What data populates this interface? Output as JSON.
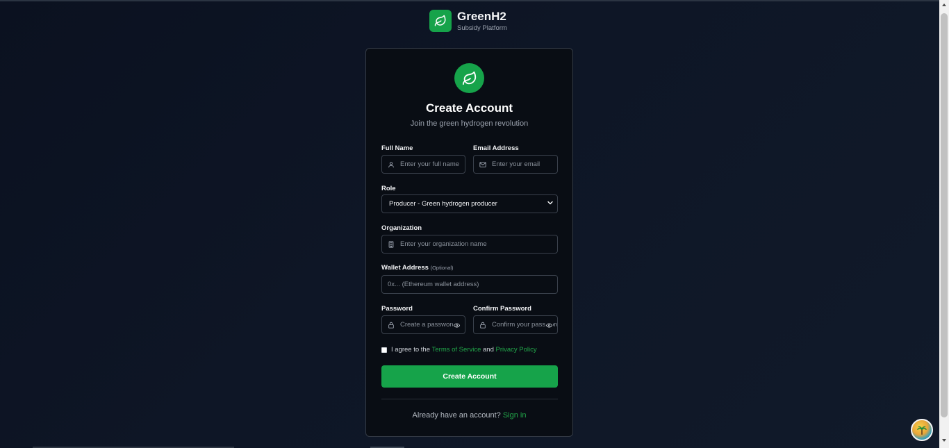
{
  "brand": {
    "name": "GreenH2",
    "subtitle": "Subsidy Platform"
  },
  "card": {
    "title": "Create Account",
    "subtitle": "Join the green hydrogen revolution"
  },
  "form": {
    "full_name": {
      "label": "Full Name",
      "placeholder": "Enter your full name"
    },
    "email": {
      "label": "Email Address",
      "placeholder": "Enter your email"
    },
    "role": {
      "label": "Role",
      "selected": "Producer - Green hydrogen producer"
    },
    "organization": {
      "label": "Organization",
      "placeholder": "Enter your organization name"
    },
    "wallet": {
      "label": "Wallet Address",
      "optional": "(Optional)",
      "placeholder": "0x... (Ethereum wallet address)"
    },
    "password": {
      "label": "Password",
      "placeholder": "Create a password"
    },
    "confirm_password": {
      "label": "Confirm Password",
      "placeholder": "Confirm your password"
    },
    "agree": {
      "prefix": "I agree to the",
      "terms": "Terms of Service",
      "and": "and",
      "privacy": "Privacy Policy",
      "checked": false
    },
    "submit_label": "Create Account",
    "signin_prompt": "Already have an account?",
    "signin_link": "Sign in"
  },
  "icons": {
    "brand": "leaf-icon",
    "hero": "leaf-icon",
    "full_name": "user-icon",
    "email": "mail-icon",
    "organization": "building-icon",
    "password": "lock-icon",
    "visibility": "eye-icon",
    "select": "chevron-down-icon"
  },
  "colors": {
    "accent": "#16a34a",
    "link": "#22a84a",
    "background": "#0b1120",
    "card": "#090d14"
  }
}
